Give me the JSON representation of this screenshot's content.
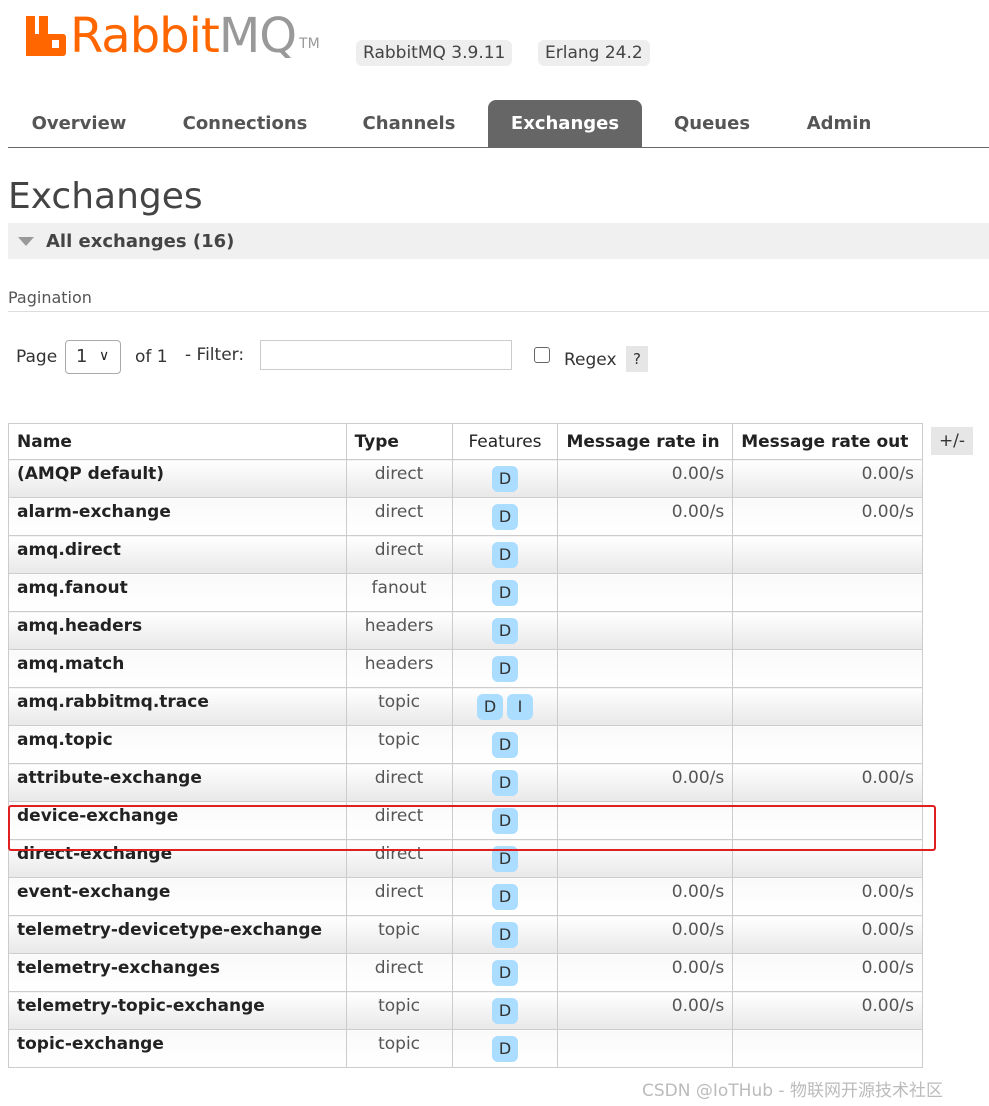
{
  "header": {
    "logo_rabbit": "Rabbit",
    "logo_mq": "MQ",
    "logo_tm": "TM",
    "version": "RabbitMQ 3.9.11",
    "erlang": "Erlang 24.2"
  },
  "nav": {
    "tabs": [
      {
        "label": "Overview"
      },
      {
        "label": "Connections"
      },
      {
        "label": "Channels"
      },
      {
        "label": "Exchanges",
        "active": true
      },
      {
        "label": "Queues"
      },
      {
        "label": "Admin"
      }
    ]
  },
  "page_title": "Exchanges",
  "section_title": "All exchanges (16)",
  "pagination": {
    "label": "Pagination",
    "page_label": "Page",
    "page_value": "1",
    "of_label": "of 1",
    "filter_label": "- Filter:",
    "filter_value": "",
    "regex_label": "Regex",
    "help": "?"
  },
  "table": {
    "headers": [
      "Name",
      "Type",
      "Features",
      "Message rate in",
      "Message rate out"
    ],
    "toggle_columns": "+/-",
    "rows": [
      {
        "name": "(AMQP default)",
        "type": "direct",
        "features": [
          "D"
        ],
        "rate_in": "0.00/s",
        "rate_out": "0.00/s"
      },
      {
        "name": "alarm-exchange",
        "type": "direct",
        "features": [
          "D"
        ],
        "rate_in": "0.00/s",
        "rate_out": "0.00/s"
      },
      {
        "name": "amq.direct",
        "type": "direct",
        "features": [
          "D"
        ],
        "rate_in": "",
        "rate_out": ""
      },
      {
        "name": "amq.fanout",
        "type": "fanout",
        "features": [
          "D"
        ],
        "rate_in": "",
        "rate_out": ""
      },
      {
        "name": "amq.headers",
        "type": "headers",
        "features": [
          "D"
        ],
        "rate_in": "",
        "rate_out": ""
      },
      {
        "name": "amq.match",
        "type": "headers",
        "features": [
          "D"
        ],
        "rate_in": "",
        "rate_out": ""
      },
      {
        "name": "amq.rabbitmq.trace",
        "type": "topic",
        "features": [
          "D",
          "I"
        ],
        "rate_in": "",
        "rate_out": ""
      },
      {
        "name": "amq.topic",
        "type": "topic",
        "features": [
          "D"
        ],
        "rate_in": "",
        "rate_out": ""
      },
      {
        "name": "attribute-exchange",
        "type": "direct",
        "features": [
          "D"
        ],
        "rate_in": "0.00/s",
        "rate_out": "0.00/s"
      },
      {
        "name": "device-exchange",
        "type": "direct",
        "features": [
          "D"
        ],
        "rate_in": "",
        "rate_out": ""
      },
      {
        "name": "direct-exchange",
        "type": "direct",
        "features": [
          "D"
        ],
        "rate_in": "",
        "rate_out": ""
      },
      {
        "name": "event-exchange",
        "type": "direct",
        "features": [
          "D"
        ],
        "rate_in": "0.00/s",
        "rate_out": "0.00/s"
      },
      {
        "name": "telemetry-devicetype-exchange",
        "type": "topic",
        "features": [
          "D"
        ],
        "rate_in": "0.00/s",
        "rate_out": "0.00/s"
      },
      {
        "name": "telemetry-exchanges",
        "type": "direct",
        "features": [
          "D"
        ],
        "rate_in": "0.00/s",
        "rate_out": "0.00/s"
      },
      {
        "name": "telemetry-topic-exchange",
        "type": "topic",
        "features": [
          "D"
        ],
        "rate_in": "0.00/s",
        "rate_out": "0.00/s"
      },
      {
        "name": "topic-exchange",
        "type": "topic",
        "features": [
          "D"
        ],
        "rate_in": "",
        "rate_out": ""
      }
    ]
  },
  "watermark": "CSDN @IoTHub - 物联网开源技术社区",
  "colors": {
    "brand_orange": "#ff6600",
    "tab_active": "#666666",
    "badge": "#aaddff",
    "highlight": "#e02020"
  }
}
